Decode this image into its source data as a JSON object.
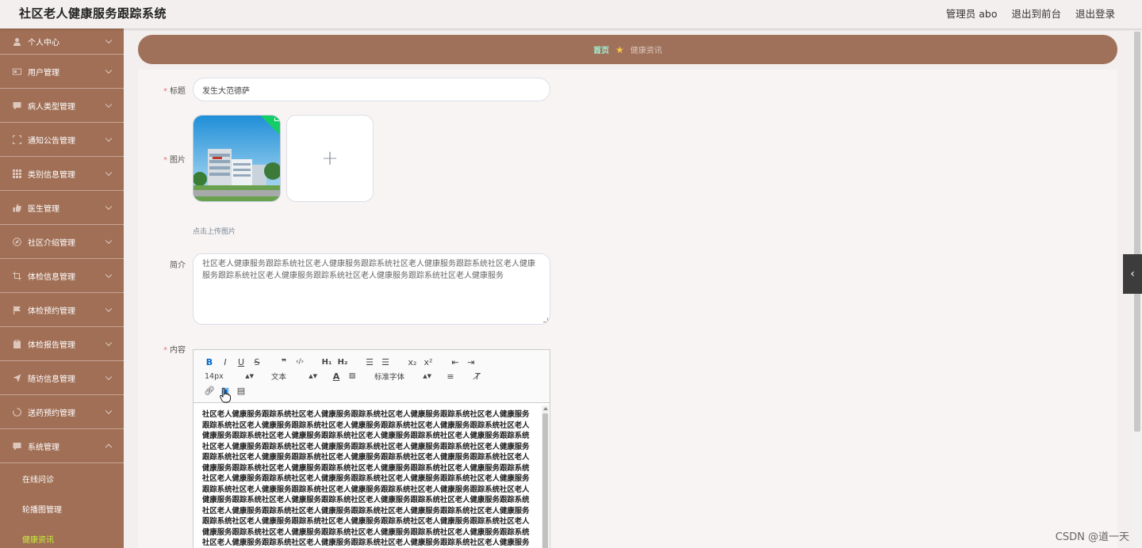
{
  "header": {
    "title": "社区老人健康服务跟踪系统",
    "user": "管理员 abo",
    "to_front": "退出到前台",
    "logout": "退出登录"
  },
  "sidebar": {
    "items": [
      {
        "label": "个人中心",
        "icon": "user-icon"
      },
      {
        "label": "用户管理",
        "icon": "id-card-icon"
      },
      {
        "label": "病人类型管理",
        "icon": "chat-icon"
      },
      {
        "label": "通知公告管理",
        "icon": "expand-icon"
      },
      {
        "label": "类别信息管理",
        "icon": "grid-icon"
      },
      {
        "label": "医生管理",
        "icon": "thumb-up-icon"
      },
      {
        "label": "社区介绍管理",
        "icon": "compass-icon"
      },
      {
        "label": "体检信息管理",
        "icon": "crop-icon"
      },
      {
        "label": "体检预约管理",
        "icon": "flag-icon"
      },
      {
        "label": "体检报告管理",
        "icon": "clipboard-icon"
      },
      {
        "label": "随访信息管理",
        "icon": "send-icon"
      },
      {
        "label": "送药预约管理",
        "icon": "loading-icon"
      },
      {
        "label": "系统管理",
        "icon": "chat-icon"
      }
    ],
    "sub_items": [
      {
        "label": "在线问诊"
      },
      {
        "label": "轮播图管理"
      },
      {
        "label": "健康资讯"
      }
    ]
  },
  "breadcrumb": {
    "home": "首页",
    "current": "健康资讯"
  },
  "form": {
    "title_label": "标题",
    "title_value": "发生大范德萨",
    "image_label": "图片",
    "upload_tip": "点击上传图片",
    "intro_label": "简介",
    "intro_value": "社区老人健康服务跟踪系统社区老人健康服务跟踪系统社区老人健康服务跟踪系统社区老人健康服务跟踪系统社区老人健康服务跟踪系统社区老人健康服务跟踪系统社区老人健康服务",
    "content_label": "内容"
  },
  "editor": {
    "font_size": "14px",
    "paragraph": "文本",
    "font_family": "标准字体",
    "content": "社区老人健康服务跟踪系统社区老人健康服务跟踪系统社区老人健康服务跟踪系统社区老人健康服务跟踪系统社区老人健康服务跟踪系统社区老人健康服务跟踪系统社区老人健康服务跟踪系统社区老人健康服务跟踪系统社区老人健康服务跟踪系统社区老人健康服务跟踪系统社区老人健康服务跟踪系统社区老人健康服务跟踪系统社区老人健康服务跟踪系统社区老人健康服务跟踪系统社区老人健康服务跟踪系统社区老人健康服务跟踪系统社区老人健康服务跟踪系统社区老人健康服务跟踪系统社区老人健康服务跟踪系统社区老人健康服务跟踪系统社区老人健康服务跟踪系统社区老人健康服务跟踪系统社区老人健康服务跟踪系统社区老人健康服务跟踪系统社区老人健康服务跟踪系统社区老人健康服务跟踪系统社区老人健康服务跟踪系统社区老人健康服务跟踪系统社区老人健康服务跟踪系统社区老人健康服务跟踪系统社区老人健康服务跟踪系统社区老人健康服务跟踪系统社区老人健康服务跟踪系统社区老人健康服务跟踪系统社区老人健康服务跟踪系统社区老人健康服务跟踪系统社区老人健康服务跟踪系统社区老人健康服务跟踪系统社区老人健康服务跟踪系统社区老人健康服务跟踪系统社区老人健康服务跟踪系统社区老人健康服务跟踪系统社区老人健康服务跟踪系统社区老人健康服务跟踪系统社区老人健康服务跟踪系统社区老人健康服务跟踪系统社区老人健康服务跟踪系统社区老人健康服务跟踪系统社区老人健康服务跟踪系统社区老人健康服务跟踪系统社区老人健康服务跟踪系统社区老人健康服务跟踪系统社区老人健康服务跟踪系统社区老人健康服务跟踪系统社区老人健康服务跟踪系统社区老人健康服务跟踪系统社区老人健康服务跟踪系统社区老人健康服务跟踪系统社区老人健康服务跟踪系统社区老人健康服务跟踪系统社区老人健康服务跟踪系统社区老人健康服务跟踪系统社区老人健康服务跟踪系统社区老人健康服务跟踪系统社区老人健康服务跟踪系统社区老人健康服务跟踪系统社区老人健康服务跟踪系统社区老人健康服务跟踪系统社区老人健康服务跟踪系统社区老人健康服务跟踪系统社区老人健康服务跟踪系统社区老人健康服务跟踪系统社区老人健康服务跟踪系统社区老人健康服务跟踪系统社区老人健康服务跟踪系统社区老人健康服务跟踪系统社区老人健康服务跟踪系统社区老人健康服务跟踪系统社区老人健康服务跟踪系统社区老人健康服务跟踪系统社区老人健康服务跟踪系统社区老人健康服务跟踪系统社区老人健康服务跟踪系统社区老人健康服务跟踪系统社区老人健康服务跟踪系统社区老人健康服务跟踪系统社区老人健康服务跟踪系统社区老人健康服务跟踪系统社区老人健康服务跟踪系统社区老人健康服务跟踪系统社区老人健康服务跟踪系统社区老人健康服务跟踪系统社区老人健康服务跟踪系统"
  },
  "watermark": "CSDN @道一天",
  "colors": {
    "sidebar": "#a16f56",
    "breadcrumb": "#a0715a",
    "active_sub": "#c7f03b",
    "required": "#f56c6c",
    "success": "#13ce66"
  }
}
